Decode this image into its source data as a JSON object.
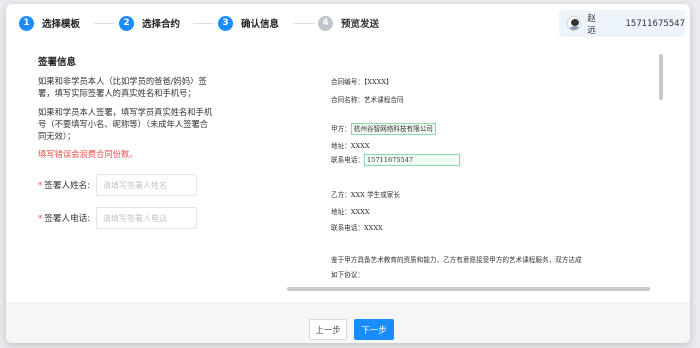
{
  "steps": [
    {
      "num": "1",
      "label": "选择模板",
      "state": "active"
    },
    {
      "num": "2",
      "label": "选择合约",
      "state": "active"
    },
    {
      "num": "3",
      "label": "确认信息",
      "state": "active"
    },
    {
      "num": "4",
      "label": "预览发送",
      "state": "inactive"
    }
  ],
  "user": {
    "name": "赵远",
    "phone": "15711675547",
    "avatar_icon": "user-avatar-icon"
  },
  "signing": {
    "title": "签署信息",
    "para1": "如果和非学员本人（比如学员的爸爸/妈妈）签署，填写实际签署人的真实姓名和手机号；",
    "para2": "如果和学员本人签署，填写学员真实姓名和手机号（不要填写小名、昵称等）（未成年人签署合同无效）；",
    "warning": "填写错误会浪费合同份数。",
    "warning_color": "#f0524b"
  },
  "form": {
    "name_label": "签署人姓名:",
    "name_placeholder": "请填写签署人姓名",
    "phone_label": "签署人电话:",
    "phone_placeholder": "请填写签署人电话",
    "required_mark": "*"
  },
  "contract": {
    "number": "合同编号：【XXXX】",
    "name": "合同名称：艺术课程合同",
    "party_a_prefix": "甲方：",
    "party_a_value": "杭州谷智网络科技有限公司",
    "address_a": "地址：XXXX",
    "phone_a_prefix": "联系电话：",
    "phone_a_value": "15711675547",
    "party_b": "乙方：XXX 学生或家长",
    "address_b": "地址：XXXX",
    "phone_b": "联系电话：XXXX",
    "clause": "鉴于甲方具备艺术教育的资质和能力，乙方有意愿接受甲方的艺术课程服务，双方达成",
    "clause2": "如下协议："
  },
  "footer": {
    "prev_label": "上一步",
    "next_label": "下一步"
  },
  "colors": {
    "accent": "#1a8cff",
    "highlight_border": "#8fd9a8"
  }
}
